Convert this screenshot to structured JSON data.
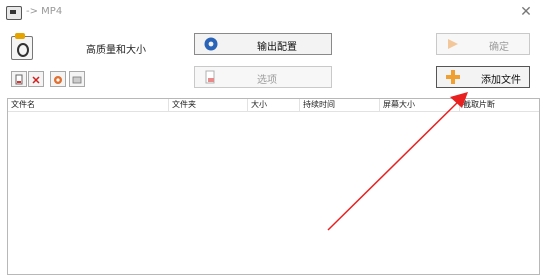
{
  "window": {
    "title": "-> MP4",
    "close_glyph": "✕"
  },
  "profile": {
    "label": "高质量和大小"
  },
  "toolbar": {
    "mini_icons": [
      "file-icon",
      "delete-icon",
      "settings-icon",
      "play-icon"
    ],
    "output_settings_label": "输出配置",
    "options_label": "选项",
    "confirm_label": "确定",
    "add_file_label": "添加文件"
  },
  "file_table": {
    "columns": [
      "文件名",
      "文件夹",
      "大小",
      "持续时间",
      "屏幕大小",
      "截取片断"
    ],
    "rows": []
  },
  "colors": {
    "accent_orange": "#f0a030",
    "annotation_red": "#e82020"
  }
}
